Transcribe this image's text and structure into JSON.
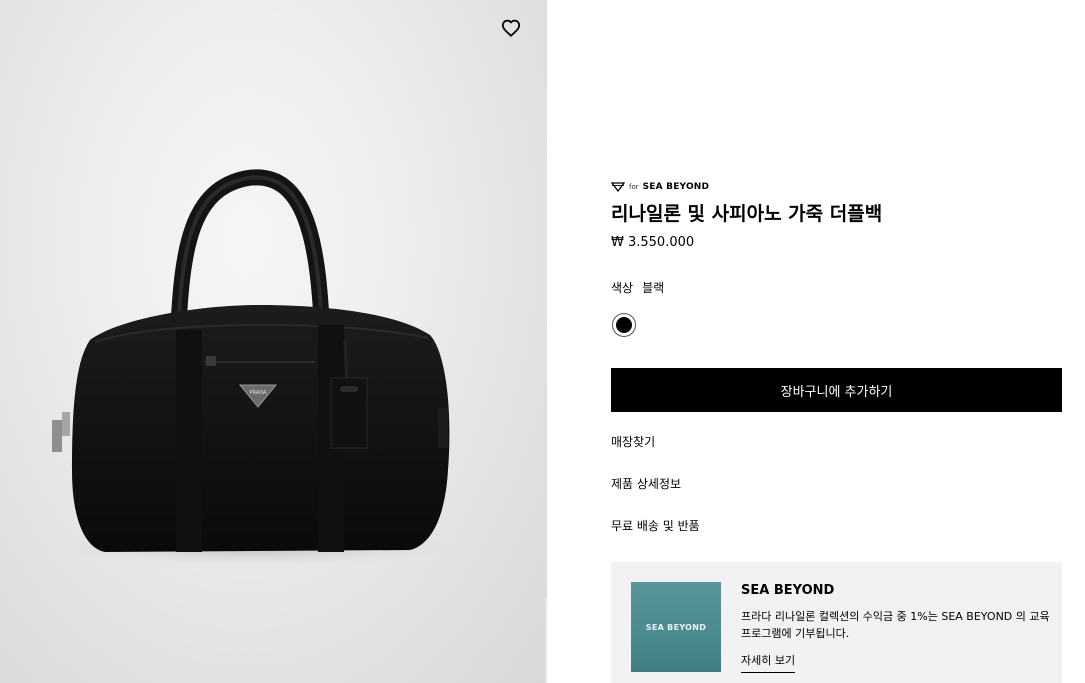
{
  "product": {
    "brand_prefix": "for",
    "brand_name": "SEA BEYOND",
    "title": "리나일론 및 사피아노 가죽 더플백",
    "price": "₩ 3.550.000",
    "color_label": "색상",
    "color_value": "블랙",
    "swatch_color": "#000000"
  },
  "actions": {
    "add_to_cart": "장바구니에 추가하기"
  },
  "links": [
    {
      "label": "매장찾기"
    },
    {
      "label": "제품 상세정보"
    },
    {
      "label": "무료 배송 및 반품"
    }
  ],
  "promo": {
    "image_text": "SEA BEYOND",
    "title": "SEA BEYOND",
    "text": "프라다 리나일론 컬렉션의 수익금 중 1%는 SEA BEYOND 의 교육 프로그램에 기부됩니다.",
    "link": "자세히 보기",
    "image_color": "#4a8b90"
  },
  "image": {
    "logo_text": "PRADA"
  },
  "icons": {
    "wishlist": "heart-outline-icon",
    "brand": "diamond-icon"
  }
}
